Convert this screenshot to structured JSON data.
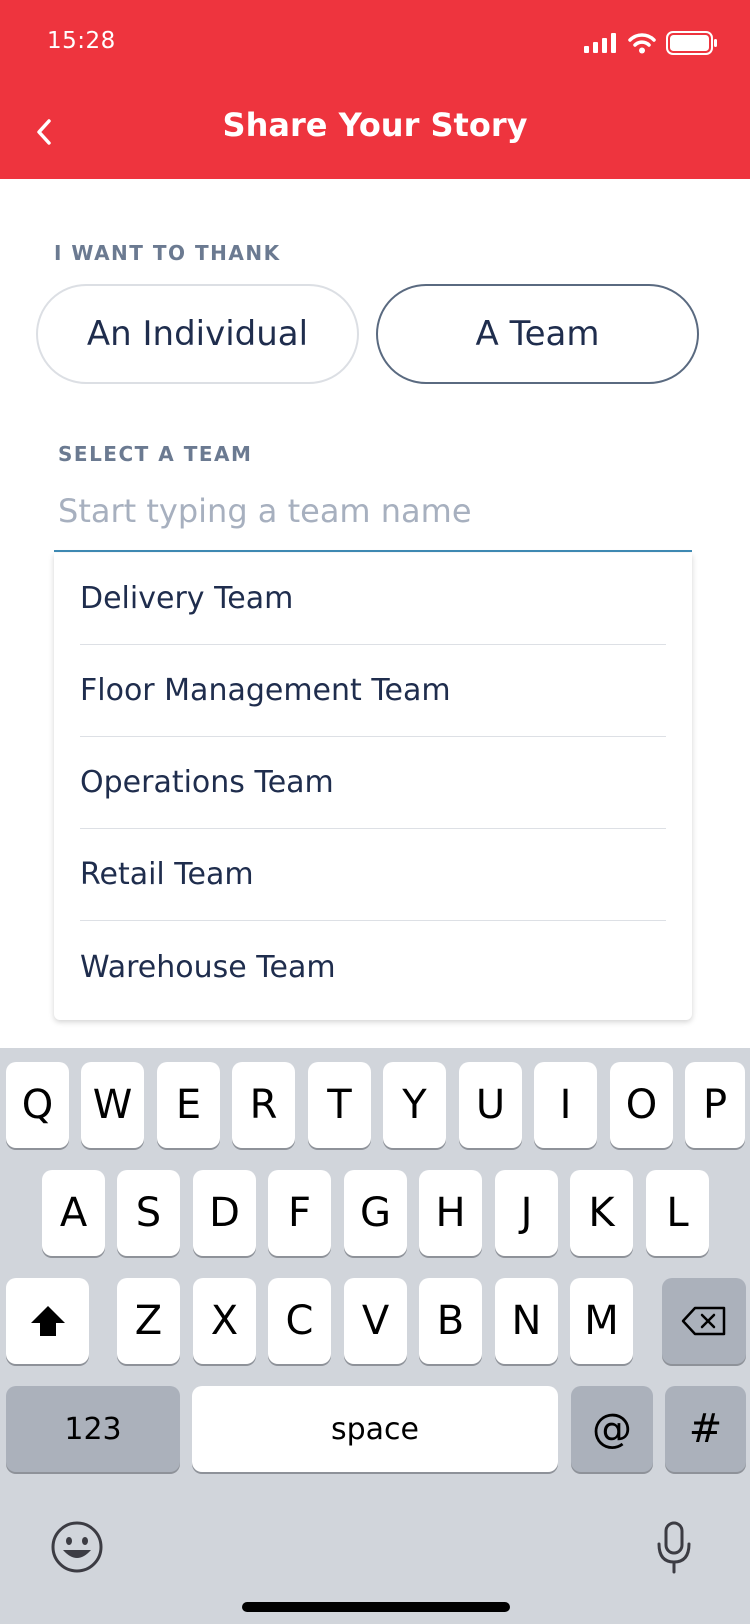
{
  "status_bar": {
    "time": "15:28"
  },
  "nav": {
    "back_icon": "chevron-left-icon",
    "title": "Share Your Story"
  },
  "thank": {
    "label": "I WANT TO THANK",
    "options": [
      "An Individual",
      "A Team"
    ],
    "selected": "A Team"
  },
  "team": {
    "label": "SELECT A TEAM",
    "input_value": "",
    "placeholder": "Start typing a team name",
    "suggestions": [
      "Delivery Team",
      "Floor Management Team",
      "Operations Team",
      "Retail Team",
      "Warehouse Team"
    ]
  },
  "keyboard": {
    "row1": [
      "Q",
      "W",
      "E",
      "R",
      "T",
      "Y",
      "U",
      "I",
      "O",
      "P"
    ],
    "row2": [
      "A",
      "S",
      "D",
      "F",
      "G",
      "H",
      "J",
      "K",
      "L"
    ],
    "row3": [
      "Z",
      "X",
      "C",
      "V",
      "B",
      "N",
      "M"
    ],
    "numbers_label": "123",
    "space_label": "space",
    "at_label": "@",
    "hash_label": "#",
    "shift_icon": "shift-icon",
    "backspace_icon": "backspace-icon",
    "emoji_icon": "emoji-icon",
    "mic_icon": "microphone-icon"
  },
  "colors": {
    "brand_red": "#ee343e",
    "text_navy": "#1f2d4d",
    "label_gray": "#6b7a91",
    "input_underline": "#3f8bb5"
  }
}
